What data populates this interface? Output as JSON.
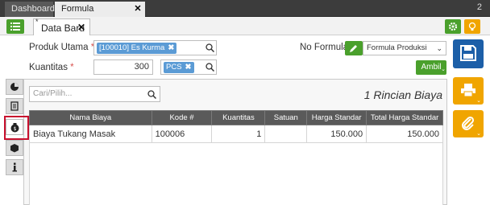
{
  "top_tabs": [
    {
      "label": "Dashboard"
    },
    {
      "label": "Formula Produksi"
    }
  ],
  "top_right_count": "2",
  "doc_tab": {
    "label": "Data Baru",
    "modified_mark": "*"
  },
  "form": {
    "produk_utama_label": "Produk Utama",
    "produk_utama_value": "[100010] Es Kurma",
    "kuantitas_label": "Kuantitas",
    "kuantitas_value": "300",
    "unit_value": "PCS",
    "required_mark": "*",
    "no_formula_label": "No Formula #",
    "no_formula_select": "Formula Produksi",
    "ambil_label": "Ambil"
  },
  "detail": {
    "search_placeholder": "Cari/Pilih...",
    "summary": "1 Rincian Biaya",
    "columns": [
      "Nama Biaya",
      "Kode #",
      "Kuantitas",
      "Satuan",
      "Harga Standar",
      "Total Harga Standar"
    ],
    "rows": [
      {
        "nama": "Biaya Tukang Masak",
        "kode": "100006",
        "kuantitas": "1",
        "satuan": "",
        "harga": "150.000",
        "total": "150.000"
      }
    ]
  },
  "colors": {
    "green": "#4aa02c",
    "blue": "#1c5fa8",
    "orange": "#f0a500",
    "tag": "#5b9bd5",
    "highlight": "#c8102e"
  }
}
